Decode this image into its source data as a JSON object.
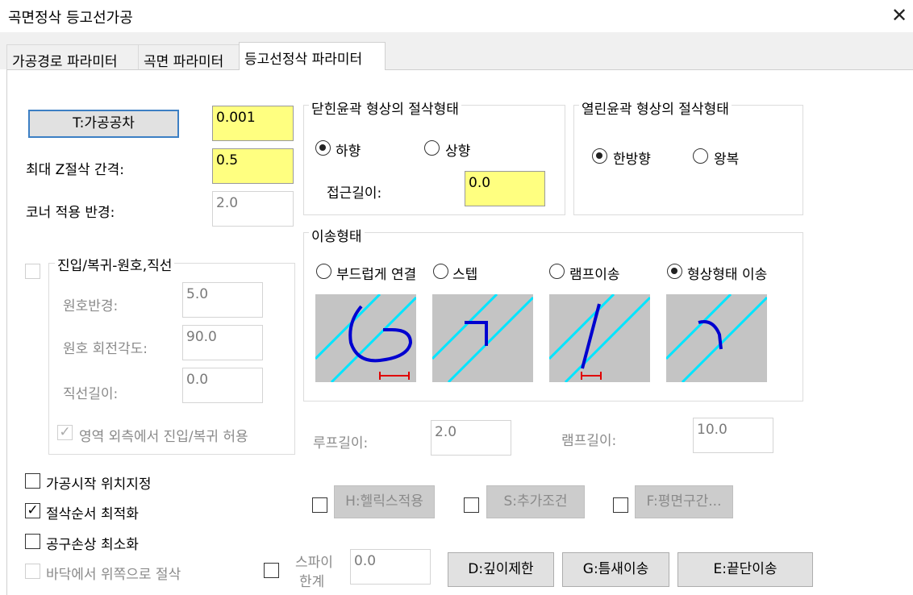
{
  "window": {
    "title": "곡면정삭 등고선가공",
    "close_glyph": "✕"
  },
  "tabs": [
    "가공경로 파라미터",
    "곡면 파라미터",
    "등고선정삭 파라미터"
  ],
  "left": {
    "tolerance_button": "T:가공공차",
    "tolerance_value": "0.001",
    "max_z_label": "최대 Z절삭 간격:",
    "max_z_value": "0.5",
    "corner_label": "코너 적용 반경:",
    "corner_value": "2.0",
    "approach_group": {
      "title": "진입/복귀-원호,직선",
      "arc_radius_label": "원호반경:",
      "arc_radius_value": "5.0",
      "arc_angle_label": "원호 회전각도:",
      "arc_angle_value": "90.0",
      "line_length_label": "직선길이:",
      "line_length_value": "0.0",
      "outside_label": "영역 외측에서 진입/복귀 허용",
      "check_glyph": "✓"
    },
    "options": [
      {
        "label": "가공시작 위치지정",
        "checked": false,
        "disabled": false
      },
      {
        "label": "절삭순서 최적화",
        "checked": true,
        "disabled": false
      },
      {
        "label": "공구손상 최소화",
        "checked": false,
        "disabled": false
      },
      {
        "label": "바닥에서 위쪽으로 절삭",
        "checked": false,
        "disabled": true
      }
    ]
  },
  "closed_contour": {
    "title": "닫힌윤곽 형상의 절삭형태",
    "down_label": "하향",
    "up_label": "상향",
    "approach_length_label": "접근길이:",
    "approach_length_value": "0.0"
  },
  "open_contour": {
    "title": "열린윤곽 형상의 절삭형태",
    "oneway_label": "한방향",
    "zigzag_label": "왕복"
  },
  "transition": {
    "title": "이송형태",
    "smooth_label": "부드럽게 연결",
    "step_label": "스텝",
    "ramp_label": "램프이송",
    "shape_label": "형상형태 이송"
  },
  "loop_length_label": "루프길이:",
  "loop_length_value": "2.0",
  "ramp_length_label": "램프길이:",
  "ramp_length_value": "10.0",
  "helix_button": "H:헬릭스적용",
  "extra_button": "S:추가조건",
  "flat_button": "F:평면구간...",
  "spiral_label_1": "스파이",
  "spiral_label_2": "한계",
  "spiral_value": "0.0",
  "depth_button": "D:깊이제한",
  "gap_button": "G:틈새이송",
  "edge_button": "E:끝단이송",
  "colors": {
    "highlight": "#ffff80",
    "preview_bg": "#c4c4c4",
    "path_blue": "#0000d0",
    "guide_cyan": "#00e5ff",
    "marker_red": "#e00000"
  }
}
